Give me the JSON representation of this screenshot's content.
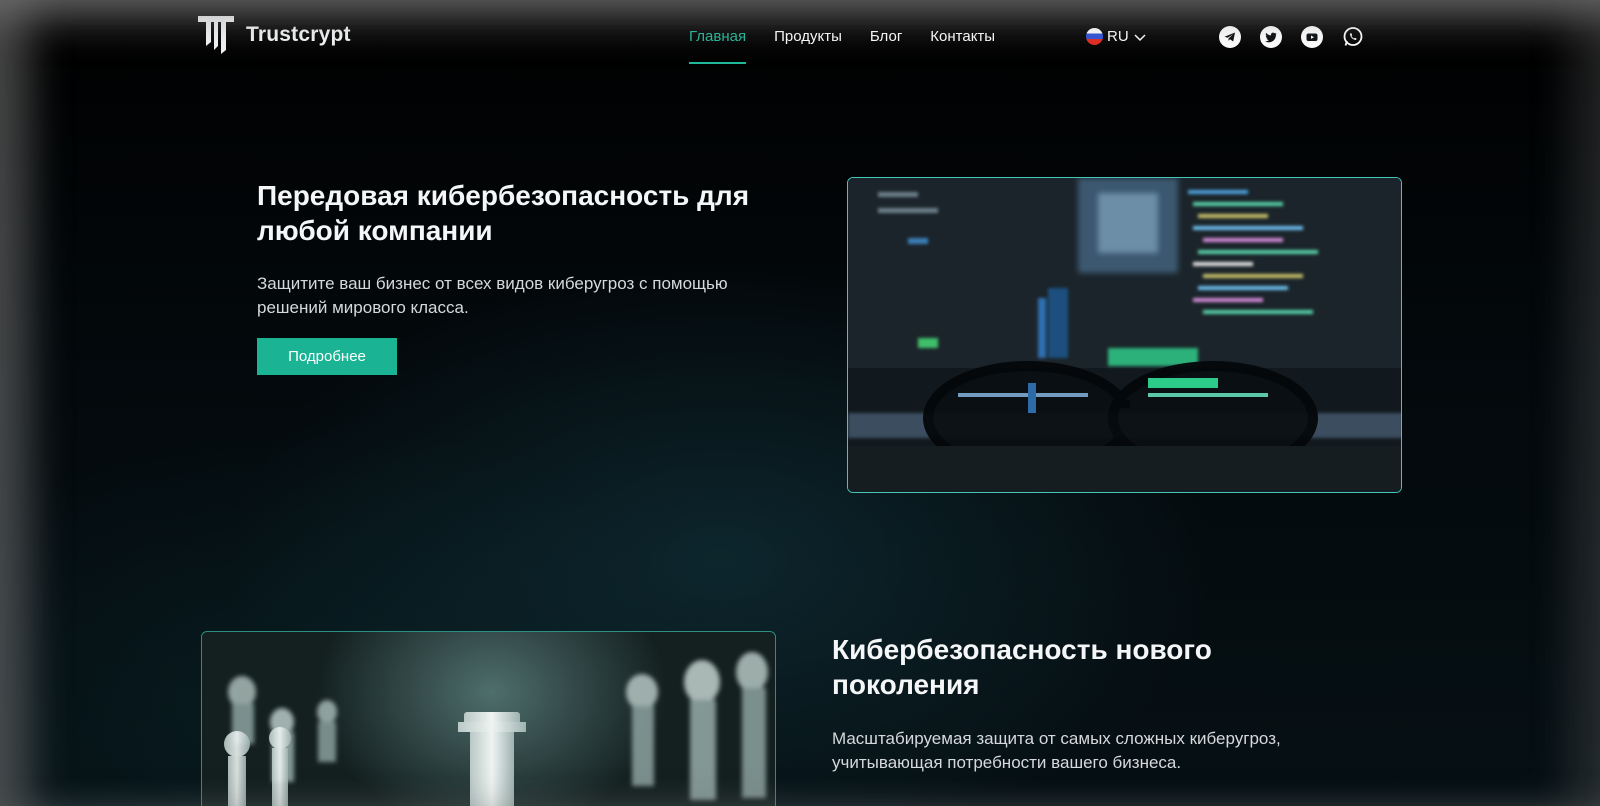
{
  "header": {
    "brand": "Trustcrypt",
    "nav": [
      {
        "label": "Главная",
        "active": true
      },
      {
        "label": "Продукты",
        "active": false
      },
      {
        "label": "Блог",
        "active": false
      },
      {
        "label": "Контакты",
        "active": false
      }
    ],
    "language": {
      "code": "RU",
      "flag_icon": "russia-flag-icon"
    },
    "socials": [
      "telegram-icon",
      "twitter-icon",
      "youtube-icon",
      "whatsapp-icon"
    ]
  },
  "hero": {
    "title": "Передовая кибербезопасность для любой компании",
    "text": "Защитите ваш бизнес от всех видов киберугроз с помощью решений мирового класса.",
    "button_label": "Подробнее",
    "image": "code-screen-glasses-photo"
  },
  "section2": {
    "title": "Кибербезопасность нового поколения",
    "text": "Масштабируемая защита от самых сложных киберугроз, учитывающая потребности вашего бизнеса.",
    "image": "chess-pieces-photo"
  },
  "colors": {
    "accent": "#1ab394",
    "background": "#05080b",
    "image_border": "#44c6b9"
  }
}
